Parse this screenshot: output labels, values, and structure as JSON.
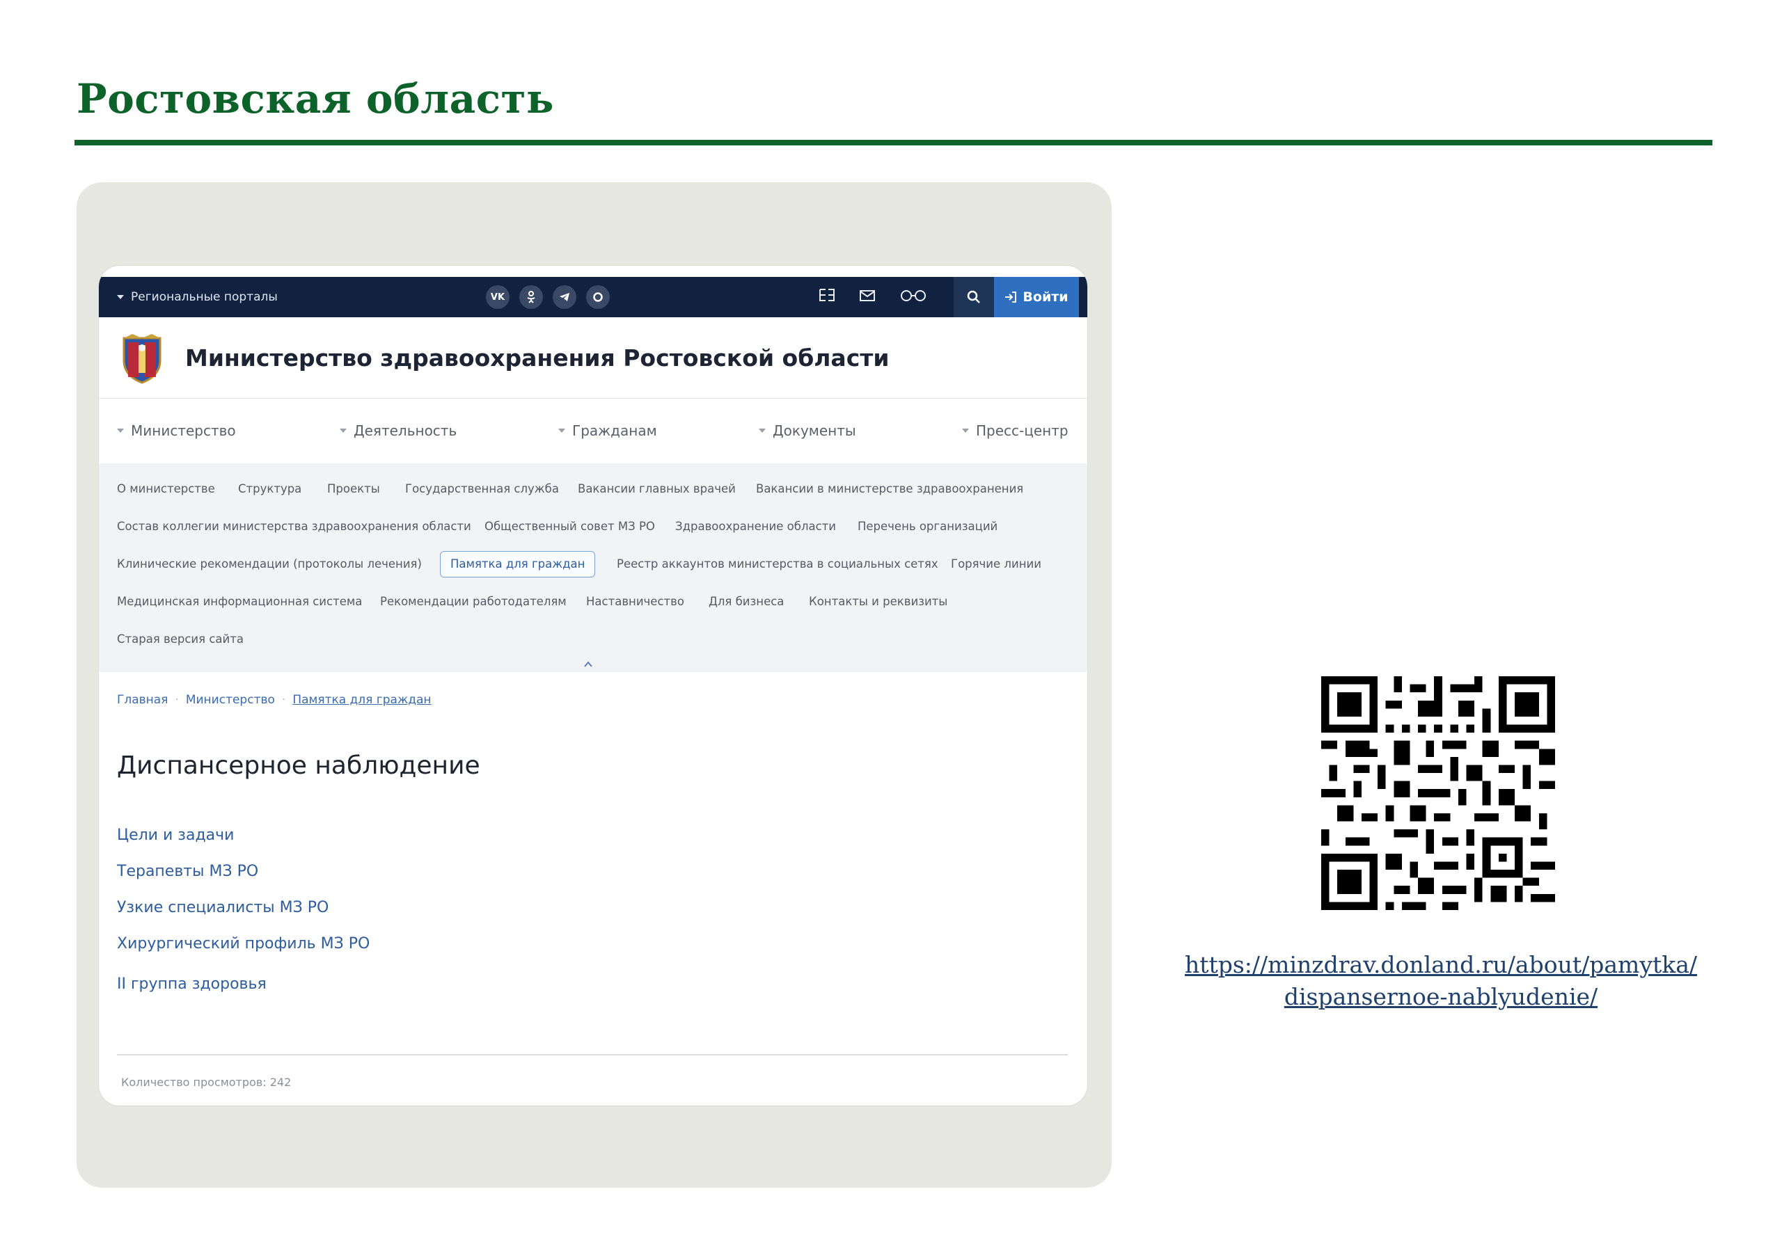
{
  "slide": {
    "title": "Ростовская область",
    "qr_url_line1": "https://minzdrav.donland.ru/about/pamytka/",
    "qr_url_line2": "dispansernoe-nablyudenie/"
  },
  "topbar": {
    "regional_portals": "Региональные порталы",
    "social_vk": "VK",
    "login_label": "Войти"
  },
  "header": {
    "ministry_name": "Министерство здравоохранения Ростовской области"
  },
  "main_nav": [
    "Министерство",
    "Деятельность",
    "Гражданам",
    "Документы",
    "Пресс-центр"
  ],
  "sub_nav": [
    "О министерстве",
    "Структура",
    "Проекты",
    "Государственная служба",
    "Вакансии главных врачей",
    "Вакансии в министерстве здравоохранения",
    "Состав коллегии министерства здравоохранения области",
    "Общественный совет МЗ РО",
    "Здравоохранение области",
    "Перечень организаций",
    "Клинические рекомендации (протоколы лечения)",
    "Памятка для граждан",
    "Реестр аккаунтов министерства в социальных сетях",
    "Горячие линии",
    "Медицинская информационная система",
    "Рекомендации работодателям",
    "Наставничество",
    "Для бизнеса",
    "Контакты и реквизиты",
    "Старая версия сайта"
  ],
  "breadcrumbs": [
    "Главная",
    "Министерство",
    "Памятка для граждан"
  ],
  "page": {
    "title": "Диспансерное наблюдение",
    "links": [
      "Цели и задачи",
      "Терапевты МЗ РО",
      "Узкие специалисты МЗ РО",
      "Хирургический профиль МЗ РО",
      "II группа здоровья"
    ],
    "views": "Количество просмотров: 242"
  },
  "colors": {
    "brand_green": "#0c6229",
    "topbar_navy": "#112240",
    "link_blue": "#2d5d9f"
  }
}
